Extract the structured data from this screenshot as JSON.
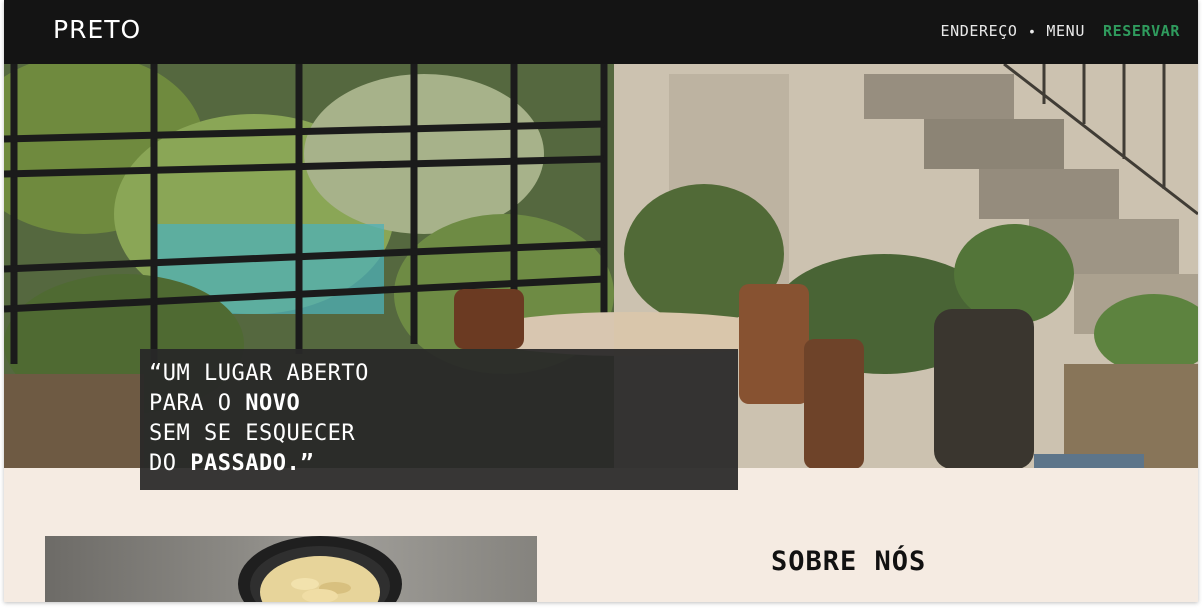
{
  "header": {
    "logo": "PRETO",
    "nav": {
      "address": "ENDEREÇO",
      "separator": "•",
      "menu": "MENU",
      "reserve": "RESERVAR"
    }
  },
  "hero": {
    "image": "restaurant-interior-photo",
    "quote": {
      "line1": "“UM LUGAR ABERTO",
      "line2_pre": "PARA O ",
      "line2_bold": "NOVO",
      "line3": "SEM SE ESQUECER",
      "line4_pre": "DO ",
      "line4_bold": "PASSADO.”"
    }
  },
  "about": {
    "title": "SOBRE NÓS",
    "image": "pasta-bowl-photo"
  },
  "colors": {
    "header_bg": "#141414",
    "accent_green": "#2f9b5d",
    "page_bg": "#f5ebe2",
    "quote_bg": "#282828"
  }
}
